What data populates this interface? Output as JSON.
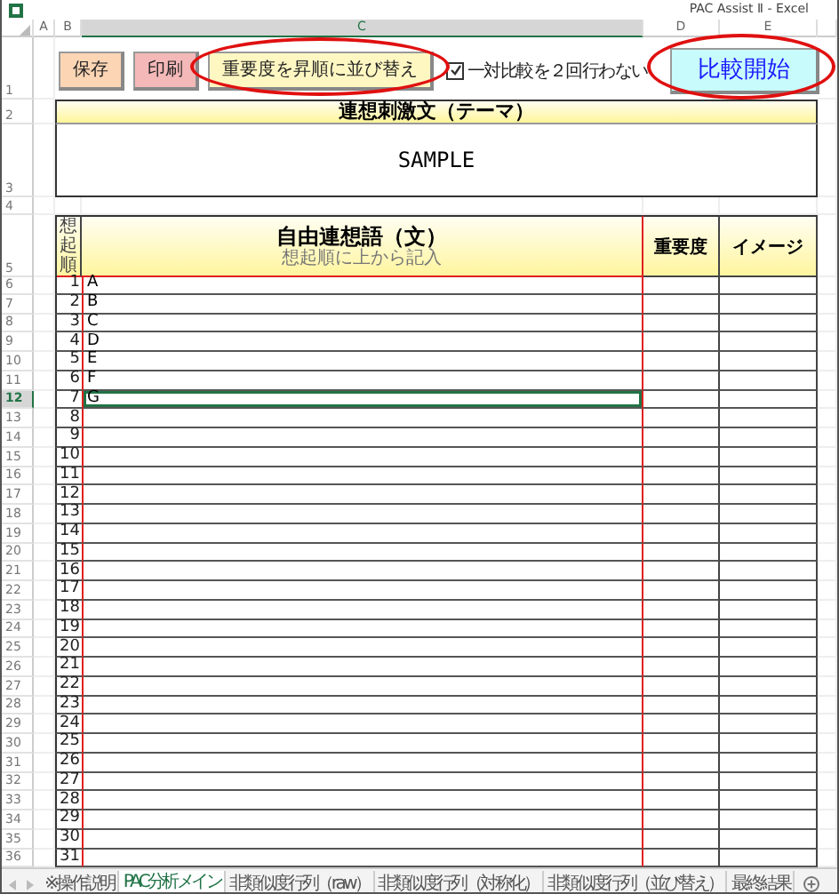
{
  "window": {
    "title": "PAC Assist Ⅱ - Excel"
  },
  "column_headers": [
    {
      "label": "A",
      "selected": false
    },
    {
      "label": "B",
      "selected": false
    },
    {
      "label": "C",
      "selected": true
    },
    {
      "label": "D",
      "selected": false
    },
    {
      "label": "E",
      "selected": false
    }
  ],
  "top_rows": [
    "1",
    "2",
    "3",
    "4",
    "5"
  ],
  "controls": [
    {
      "kind": "button",
      "label": "保存",
      "color": "#fcd5b4",
      "circled": false
    },
    {
      "kind": "button",
      "label": "印刷",
      "color": "#f4b8b8",
      "circled": false
    },
    {
      "kind": "button",
      "label": "重要度を昇順に並び替え",
      "color": "#fff7c2",
      "circled": true
    },
    {
      "kind": "checkbox",
      "label": "一対比較を２回行わない",
      "checked": true
    },
    {
      "kind": "button",
      "label": "比較開始",
      "color": "#c8fcfc",
      "circled": true
    }
  ],
  "theme": {
    "heading": "連想刺激文（テーマ）",
    "text": "SAMPLE"
  },
  "table": {
    "order_heading": "想起順",
    "main_heading": "自由連想語（文）",
    "main_subheading": "想起順に上から記入",
    "importance_heading": "重要度",
    "image_heading": "イメージ",
    "rows": [
      {
        "row_number": "6",
        "order": "1",
        "text": "A",
        "selected": false
      },
      {
        "row_number": "7",
        "order": "2",
        "text": "B",
        "selected": false
      },
      {
        "row_number": "8",
        "order": "3",
        "text": "C",
        "selected": false
      },
      {
        "row_number": "9",
        "order": "4",
        "text": "D",
        "selected": false
      },
      {
        "row_number": "10",
        "order": "5",
        "text": "E",
        "selected": false
      },
      {
        "row_number": "11",
        "order": "6",
        "text": "F",
        "selected": false
      },
      {
        "row_number": "12",
        "order": "7",
        "text": "G",
        "selected": true
      },
      {
        "row_number": "13",
        "order": "8",
        "selected": false
      },
      {
        "row_number": "14",
        "order": "9",
        "selected": false
      },
      {
        "row_number": "15",
        "order": "10",
        "selected": false
      },
      {
        "row_number": "16",
        "order": "11",
        "selected": false
      },
      {
        "row_number": "17",
        "order": "12",
        "selected": false
      },
      {
        "row_number": "18",
        "order": "13",
        "selected": false
      },
      {
        "row_number": "19",
        "order": "14",
        "selected": false
      },
      {
        "row_number": "20",
        "order": "15",
        "selected": false
      },
      {
        "row_number": "21",
        "order": "16",
        "selected": false
      },
      {
        "row_number": "22",
        "order": "17",
        "selected": false
      },
      {
        "row_number": "23",
        "order": "18",
        "selected": false
      },
      {
        "row_number": "24",
        "order": "19",
        "selected": false
      },
      {
        "row_number": "25",
        "order": "20",
        "selected": false
      },
      {
        "row_number": "26",
        "order": "21",
        "selected": false
      },
      {
        "row_number": "27",
        "order": "22",
        "selected": false
      },
      {
        "row_number": "28",
        "order": "23",
        "selected": false
      },
      {
        "row_number": "29",
        "order": "24",
        "selected": false
      },
      {
        "row_number": "30",
        "order": "25",
        "selected": false
      },
      {
        "row_number": "31",
        "order": "26",
        "selected": false
      },
      {
        "row_number": "32",
        "order": "27",
        "selected": false
      },
      {
        "row_number": "33",
        "order": "28",
        "selected": false
      },
      {
        "row_number": "34",
        "order": "29",
        "selected": false
      },
      {
        "row_number": "35",
        "order": "30",
        "selected": false
      },
      {
        "row_number": "36",
        "order": "31",
        "selected": false
      }
    ]
  },
  "sheet_tabs": [
    {
      "label": "※操作説明",
      "selected": false
    },
    {
      "label": "PAC分析メイン",
      "selected": true
    },
    {
      "label": "非類似度行列（raw）",
      "selected": false
    },
    {
      "label": "非類似度行列（対称化）",
      "selected": false
    },
    {
      "label": "非類似度行列（並び替え）",
      "selected": false
    },
    {
      "label": "最終結果",
      "selected": false
    }
  ]
}
